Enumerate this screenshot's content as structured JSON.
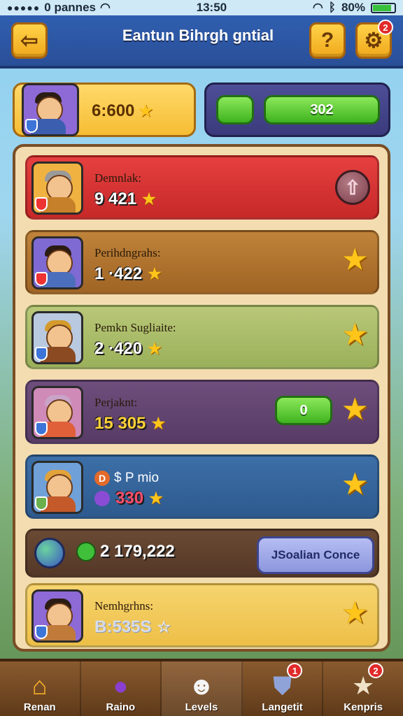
{
  "status": {
    "carrier": "0 pannes",
    "time": "13:50",
    "battery": "80%"
  },
  "header": {
    "title": "Eantun Bihrgh gntial",
    "hint_label": "?",
    "notif_count": "2"
  },
  "player_card": {
    "score": "6:600"
  },
  "progress_card": {
    "value": "302"
  },
  "rows": [
    {
      "name": "Demnlak:",
      "score": "9 421"
    },
    {
      "name": "Perihdngrahs:",
      "score": "1 ·422"
    },
    {
      "name": "Pemkn Sugliaite:",
      "score": "2 ·420"
    },
    {
      "name": "Perjaknt:",
      "score": "15 305",
      "pill_value": "0"
    },
    {
      "name": "$ P mio",
      "score": "330",
      "prefix": "D"
    },
    {
      "gems_value": "2 179,222",
      "social_label": "JSoalian Conce"
    },
    {
      "name": "Nemhgrhns:",
      "score": "B:535S"
    }
  ],
  "nav": [
    {
      "label": "Renan",
      "icon": "home-icon"
    },
    {
      "label": "Raino",
      "icon": "orb-icon"
    },
    {
      "label": "Levels",
      "icon": "skull-icon",
      "active": true
    },
    {
      "label": "Langetit",
      "icon": "shield-icon",
      "badge": "1"
    },
    {
      "label": "Kenpris",
      "icon": "star-icon",
      "badge": "2"
    }
  ]
}
